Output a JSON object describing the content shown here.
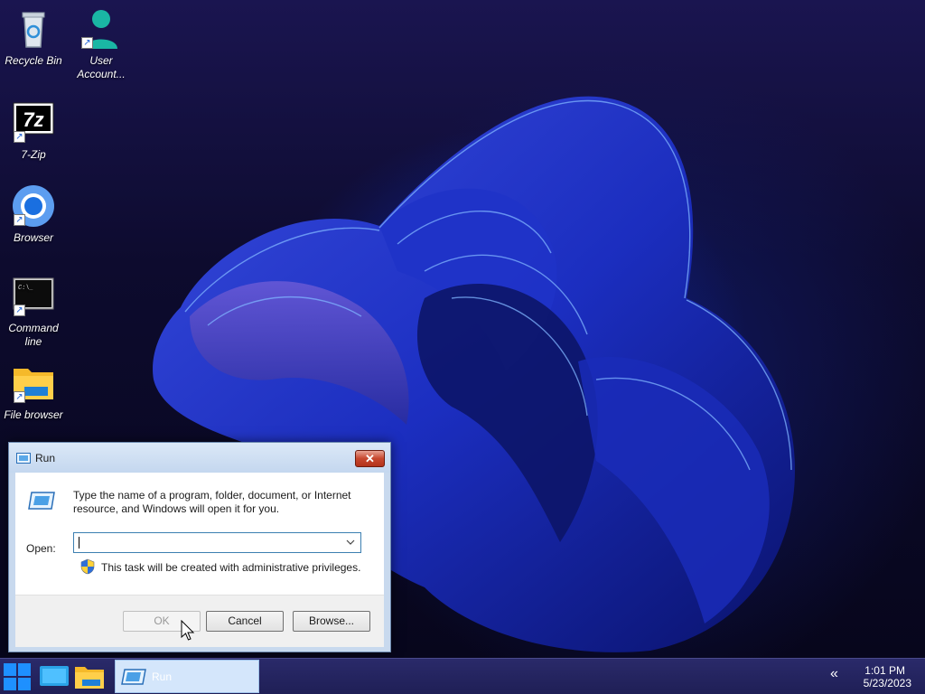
{
  "desktop": {
    "icons": [
      {
        "label": "Recycle Bin",
        "icon": "recycle-bin-icon"
      },
      {
        "label": "User Account...",
        "icon": "user-icon"
      },
      {
        "label": "7-Zip",
        "icon": "7zip-icon"
      },
      {
        "label": "Browser",
        "icon": "browser-icon"
      },
      {
        "label": "Command line",
        "icon": "terminal-icon"
      },
      {
        "label": "File browser",
        "icon": "folder-icon"
      }
    ]
  },
  "run_dialog": {
    "title": "Run",
    "close_label": "✕",
    "description": "Type the name of a program, folder, document, or Internet resource, and Windows will open it for you.",
    "open_label": "Open:",
    "open_value": "",
    "admin_note": "This task will be created with administrative privileges.",
    "ok_label": "OK",
    "cancel_label": "Cancel",
    "browse_label": "Browse..."
  },
  "taskbar": {
    "run_label": "Run",
    "chevron": "«",
    "time": "1:01 PM",
    "date": "5/23/2023"
  },
  "colors": {
    "dialog_frame": "#c8d9ee",
    "taskbar": "#1f1f56",
    "close_red": "#c7472e",
    "accent_blue": "#2b6fe0"
  }
}
